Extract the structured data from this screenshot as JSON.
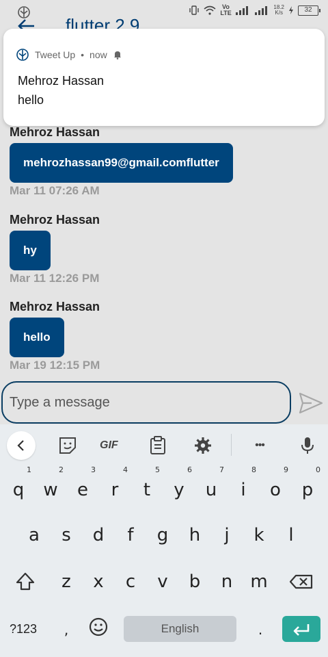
{
  "status_bar": {
    "network_label": "Vo LTE",
    "net_speed": "18.2",
    "net_speed_unit": "K/s",
    "battery": "32"
  },
  "app_bar": {
    "title": "flutter 2.9"
  },
  "notification": {
    "app_name": "Tweet Up",
    "time": "now",
    "title": "Mehroz Hassan",
    "body": "hello"
  },
  "messages": [
    {
      "sender": "Mehroz Hassan",
      "text": "mehrozhassan99@gmail.comflutter",
      "time": "Mar 11 07:26 AM"
    },
    {
      "sender": "Mehroz Hassan",
      "text": "hy",
      "time": "Mar 11 12:26 PM"
    },
    {
      "sender": "Mehroz Hassan",
      "text": "hello",
      "time": "Mar 19 12:15 PM"
    }
  ],
  "composer": {
    "placeholder": "Type a message"
  },
  "keyboard": {
    "toolbar": [
      "collapse-icon",
      "sticker-icon",
      "gif-icon",
      "clipboard-icon",
      "settings-icon",
      "more-icon",
      "mic-icon"
    ],
    "gif_label": "GIF",
    "more_label": "•••",
    "row1": [
      {
        "key": "q",
        "hint": "1"
      },
      {
        "key": "w",
        "hint": "2"
      },
      {
        "key": "e",
        "hint": "3"
      },
      {
        "key": "r",
        "hint": "4"
      },
      {
        "key": "t",
        "hint": "5"
      },
      {
        "key": "y",
        "hint": "6"
      },
      {
        "key": "u",
        "hint": "7"
      },
      {
        "key": "i",
        "hint": "8"
      },
      {
        "key": "o",
        "hint": "9"
      },
      {
        "key": "p",
        "hint": "0"
      }
    ],
    "row2": [
      "a",
      "s",
      "d",
      "f",
      "g",
      "h",
      "j",
      "k",
      "l"
    ],
    "row3": [
      "z",
      "x",
      "c",
      "v",
      "b",
      "n",
      "m"
    ],
    "symbols_label": "?123",
    "comma": ",",
    "space_label": "English",
    "period": "."
  },
  "colors": {
    "accent": "#00457c",
    "enter": "#2aa89a"
  }
}
